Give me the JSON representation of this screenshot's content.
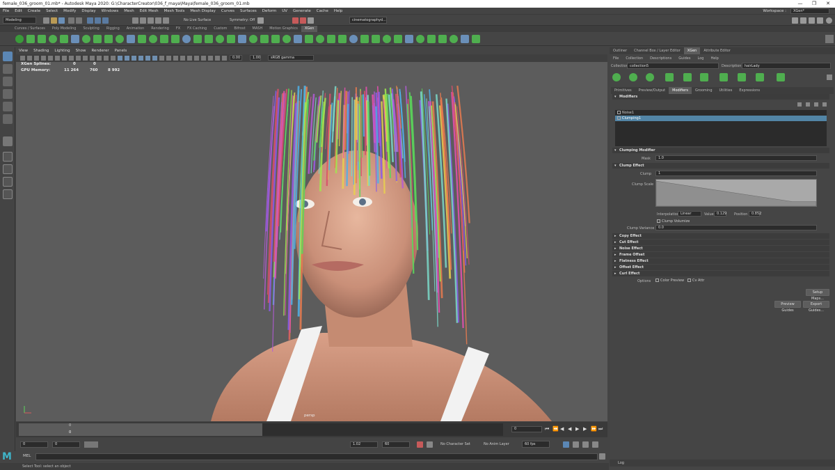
{
  "window": {
    "title": "female_036_groom_01.mb* - Autodesk Maya 2020: G:\\CharacterCreator\\036_f_maya\\Maya\\female_036_groom_01.mb",
    "controls": [
      "—",
      "❐",
      "✕"
    ]
  },
  "menubar": {
    "items": [
      "File",
      "Edit",
      "Create",
      "Select",
      "Modify",
      "Display",
      "Windows",
      "Mesh",
      "Edit Mesh",
      "Mesh Tools",
      "Mesh Display",
      "Curves",
      "Surfaces",
      "Deform",
      "UV",
      "Generate",
      "Cache",
      "Help"
    ],
    "workspace_label": "Workspace :",
    "workspace_value": "XGen*"
  },
  "statusline": {
    "mode": "Modeling",
    "live_surface": "No Live Surface",
    "symmetry": "Symmetry: Off",
    "camera": "cinematographyd..."
  },
  "shelf": {
    "tabs": [
      "Curves / Surfaces",
      "Poly Modeling",
      "Sculpting",
      "Rigging",
      "Animation",
      "Rendering",
      "FX",
      "FX Caching",
      "Custom",
      "Bifrost",
      "MASH",
      "Motion Graphics",
      "XGen"
    ],
    "active_tab": "XGen"
  },
  "viewport": {
    "menu": [
      "View",
      "Shading",
      "Lighting",
      "Show",
      "Renderer",
      "Panels"
    ],
    "exposure": "0.00",
    "gamma": "1.00",
    "colorspace": "sRGB gamma",
    "hud": {
      "row1_label": "XGen Splines:",
      "row1_v1": "0",
      "row1_v2": "0",
      "row2_label": "GPU Memory:",
      "row2_v1": "11 264",
      "row2_v2": "760",
      "row2_v3": "8 992"
    },
    "camera_label": "persp"
  },
  "timeline": {
    "tick_0": "0",
    "current_frame_top": "0",
    "current_frame_field": "0"
  },
  "range": {
    "start": "0",
    "start2": "0",
    "end_value": "1.02",
    "end2": "60",
    "character_set": "No Character Set",
    "anim_layer": "No Anim Layer",
    "fps": "60 fps"
  },
  "cmdline": {
    "mode": "MEL"
  },
  "helpline": {
    "text": "Select Tool: select an object"
  },
  "panel": {
    "tabs": [
      "Outliner",
      "Channel Box / Layer Editor",
      "XGen",
      "Attribute Editor"
    ],
    "active_tab": "XGen",
    "menu": [
      "File",
      "Collection",
      "Descriptions",
      "Guides",
      "Log",
      "Help"
    ],
    "collection_label": "Collection",
    "collection_value": "collection5",
    "description_label": "Description",
    "description_value": "hairLady",
    "subtabs": [
      "Primitives",
      "Preview/Output",
      "Modifiers",
      "Grooming",
      "Utilities",
      "Expressions"
    ],
    "active_subtab": "Modifiers",
    "modifiers_header": "Modifiers",
    "modifier_list": [
      "Noise1",
      "Clumping1"
    ],
    "clumping_header": "Clumping Modifier",
    "mask_label": "Mask",
    "mask_value": "1.0",
    "clump_effect_header": "Clump Effect",
    "clump_label": "Clump",
    "clump_value": "1",
    "clump_scale_label": "Clump Scale",
    "ramp": {
      "start": 1.0,
      "end": 0.129,
      "end_position": 0.852
    },
    "interpolation_label": "Interpolation",
    "interpolation_value": "Linear",
    "value_label": "Value",
    "value_value": "0.129",
    "position_label": "Position",
    "position_value": "0.852",
    "volumize_label": "Clump Volumize",
    "variance_label": "Clump Variance",
    "variance_value": "0.0",
    "sections": [
      "Copy Effect",
      "Cut Effect",
      "Noise Effect",
      "Frame Offset",
      "Flatness Effect",
      "Offset Effect",
      "Curl Effect"
    ],
    "options_label": "Options",
    "color_preview_label": "Color Preview",
    "cv_attr_label": "Cv Attr",
    "setup_maps": "Setup Maps...",
    "preview_guides": "Preview Guides",
    "export_guides": "Export Guides...",
    "log_label": "Log"
  }
}
